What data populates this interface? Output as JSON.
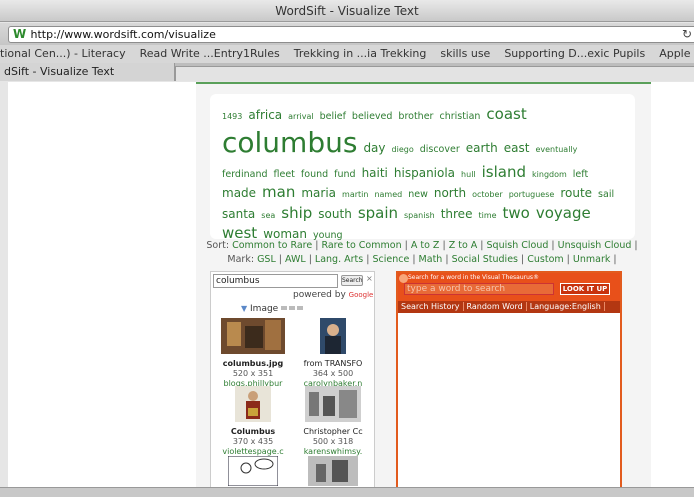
{
  "window": {
    "title": "WordSift - Visualize Text"
  },
  "address": {
    "url": "http://www.wordsift.com/visualize"
  },
  "bookmarks": [
    "tional Cen...) - Literacy",
    "Read Write ...Entry1Rules",
    "Trekking in ...ia Trekking",
    "skills use",
    "Supporting D...exic Pupils",
    "Apple"
  ],
  "tab": {
    "label": "dSift - Visualize Text"
  },
  "cloud": {
    "words": [
      {
        "w": "1493",
        "s": 1
      },
      {
        "w": "africa",
        "s": 3
      },
      {
        "w": "arrival",
        "s": 1
      },
      {
        "w": "belief",
        "s": 2
      },
      {
        "w": "believed",
        "s": 2
      },
      {
        "w": "brother",
        "s": 2
      },
      {
        "w": "christian",
        "s": 2
      },
      {
        "w": "coast",
        "s": 4
      },
      {
        "w": "columbus",
        "s": 5
      },
      {
        "w": "day",
        "s": 3
      },
      {
        "w": "diego",
        "s": 1
      },
      {
        "w": "discover",
        "s": 2
      },
      {
        "w": "earth",
        "s": 3
      },
      {
        "w": "east",
        "s": 3
      },
      {
        "w": "eventually",
        "s": 1
      },
      {
        "w": "ferdinand",
        "s": 2
      },
      {
        "w": "fleet",
        "s": 2
      },
      {
        "w": "found",
        "s": 2
      },
      {
        "w": "fund",
        "s": 2
      },
      {
        "w": "haiti",
        "s": 3
      },
      {
        "w": "hispaniola",
        "s": 3
      },
      {
        "w": "hull",
        "s": 1
      },
      {
        "w": "island",
        "s": 4
      },
      {
        "w": "kingdom",
        "s": 1
      },
      {
        "w": "left",
        "s": 2
      },
      {
        "w": "made",
        "s": 3
      },
      {
        "w": "man",
        "s": 4
      },
      {
        "w": "maria",
        "s": 3
      },
      {
        "w": "martin",
        "s": 1
      },
      {
        "w": "named",
        "s": 1
      },
      {
        "w": "new",
        "s": 2
      },
      {
        "w": "north",
        "s": 3
      },
      {
        "w": "october",
        "s": 1
      },
      {
        "w": "portuguese",
        "s": 1
      },
      {
        "w": "route",
        "s": 3
      },
      {
        "w": "sail",
        "s": 2
      },
      {
        "w": "santa",
        "s": 3
      },
      {
        "w": "sea",
        "s": 1
      },
      {
        "w": "ship",
        "s": 4
      },
      {
        "w": "south",
        "s": 3
      },
      {
        "w": "spain",
        "s": 4
      },
      {
        "w": "spanish",
        "s": 1
      },
      {
        "w": "three",
        "s": 3
      },
      {
        "w": "time",
        "s": 1
      },
      {
        "w": "two",
        "s": 4
      },
      {
        "w": "voyage",
        "s": 4
      },
      {
        "w": "west",
        "s": 4
      },
      {
        "w": "woman",
        "s": 3
      },
      {
        "w": "young",
        "s": 2
      }
    ]
  },
  "sort": {
    "prefix": "Sort:",
    "options": [
      "Common to Rare",
      "Rare to Common",
      "A to Z",
      "Z to A",
      "Squish Cloud",
      "Unsquish Cloud"
    ],
    "mark_prefix": "Mark:",
    "marks": [
      "GSL",
      "AWL",
      "Lang. Arts",
      "Science",
      "Math",
      "Social Studies",
      "Custom",
      "Unmark"
    ]
  },
  "image_search": {
    "query": "columbus",
    "search_label": "Search",
    "clear_label": "×",
    "powered_by": "powered by",
    "google": "Google",
    "toggle_label": "Image",
    "results": [
      {
        "title": "columbus.jpg",
        "size": "520 x 351",
        "site": "blogs.phillybur",
        "bold": true
      },
      {
        "title": "from TRANSFO",
        "size": "364 x 500",
        "site": "carolynbaker.n",
        "bold": false
      },
      {
        "title": "Columbus",
        "size": "370 x 435",
        "site": "violettespage.c",
        "bold": true
      },
      {
        "title": "Christopher Cc",
        "size": "500 x 318",
        "site": "karenswhimsy.",
        "bold": false
      }
    ]
  },
  "thesaurus": {
    "hint": "Search for a word in the Visual Thesaurus®",
    "placeholder": "type a word to search",
    "button": "LOOK IT UP",
    "tabs": [
      "Search History",
      "Random Word",
      "Language:English"
    ]
  }
}
